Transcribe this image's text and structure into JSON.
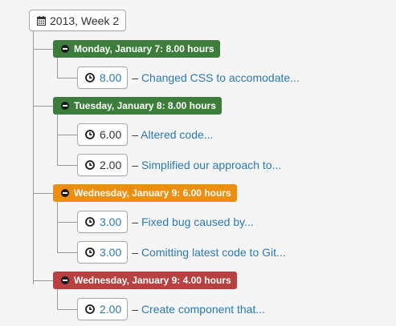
{
  "week": {
    "label": "2013, Week 2",
    "icon": "calendar-icon"
  },
  "days": [
    {
      "label": "Monday, January 7: 8.00 hours",
      "color": "#3c7d3c",
      "entries": [
        {
          "hours": "8.00",
          "description": "Changed CSS to accomodate...",
          "hours_is_link": true
        }
      ]
    },
    {
      "label": "Tuesday, January 8: 8.00 hours",
      "color": "#3c7d3c",
      "entries": [
        {
          "hours": "6.00",
          "description": "Altered code...",
          "hours_is_link": false
        },
        {
          "hours": "2.00",
          "description": "Simplified our approach to...",
          "hours_is_link": false
        }
      ]
    },
    {
      "label": "Wednesday, January 9: 6.00 hours",
      "color": "#ec8e10",
      "entries": [
        {
          "hours": "3.00",
          "description": "Fixed bug caused by...",
          "hours_is_link": true
        },
        {
          "hours": "3.00",
          "description": "Comitting latest code to Git...",
          "hours_is_link": true
        }
      ]
    },
    {
      "label": "Wednesday, January 9: 4.00 hours",
      "color": "#b84040",
      "entries": [
        {
          "hours": "2.00",
          "description": "Create component that...",
          "hours_is_link": true
        }
      ]
    }
  ],
  "separator": "–",
  "colors": {
    "link": "#2a7ab0",
    "line": "#9a9a9a"
  }
}
